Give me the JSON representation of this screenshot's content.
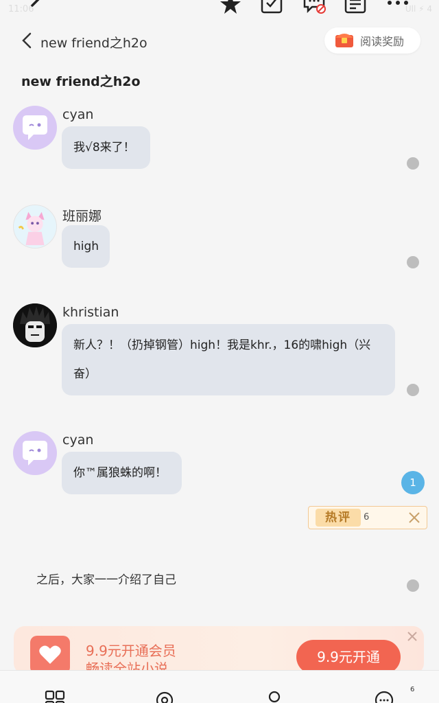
{
  "status": {
    "time": "11:06",
    "system": "Ull ⚡ 4"
  },
  "header": {
    "title": "new friend之h2o",
    "reward_label": "阅读奖励"
  },
  "chapter": {
    "title": "new friend之h2o"
  },
  "messages": [
    {
      "name": "cyan",
      "text": "我√8来了！"
    },
    {
      "name": "班丽娜",
      "text": "high"
    },
    {
      "name": "khristian",
      "text": "新人？！（扔掉钢管）high！我是khr.，16的啸high（兴",
      "text2": "奋）"
    },
    {
      "name": "cyan",
      "text": "你™属狼蛛的啊！"
    }
  ],
  "comment_count": "1",
  "hot_comment": {
    "tag": "热评",
    "count": "6"
  },
  "narration": "之后，大家一一介绍了自己",
  "promo": {
    "line1": "9.9元开通会员",
    "line2": "畅读全站小说",
    "cta": "9.9元开通"
  },
  "bottom_nav": {
    "badge": "6"
  },
  "colors": {
    "bubble": "#e1e5ec",
    "promo_cta": "#f26551",
    "badge_blue": "#5ab4e6"
  }
}
